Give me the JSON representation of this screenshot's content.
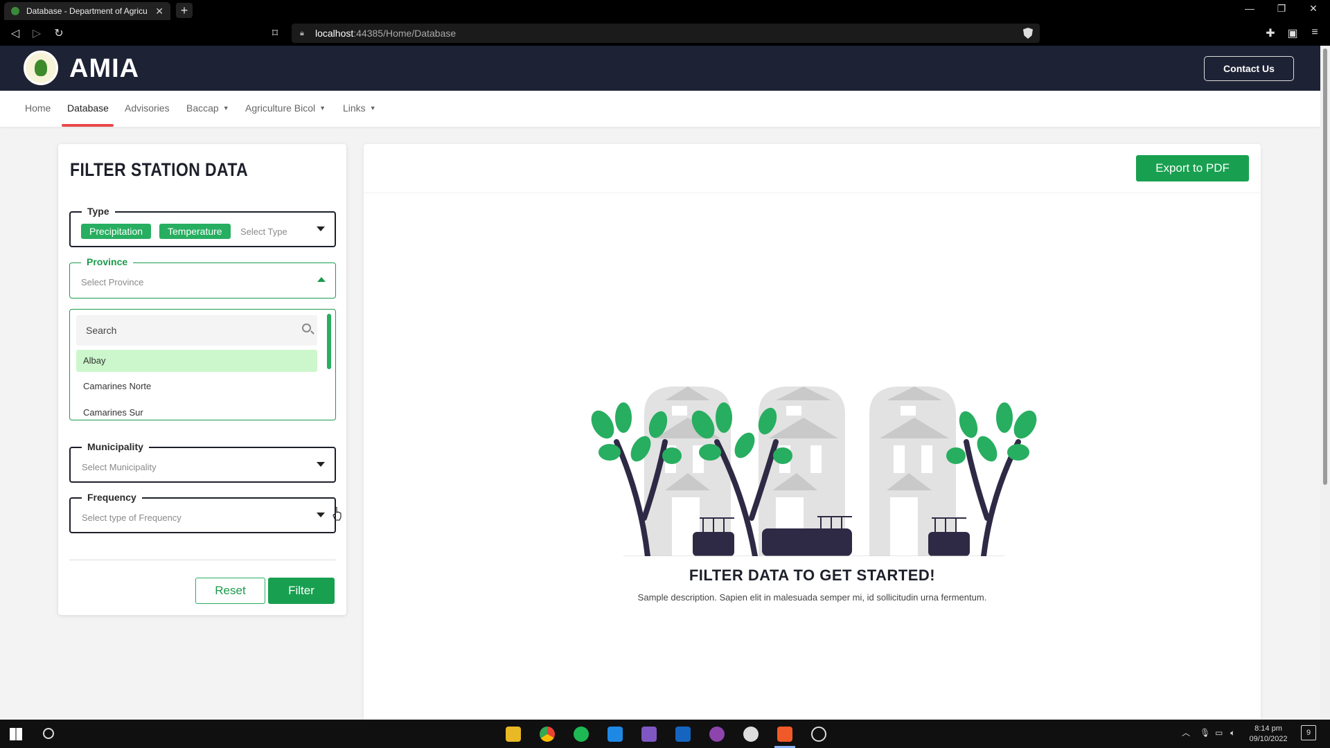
{
  "browser": {
    "tab_title": "Database - Department of Agricu",
    "url_host": "localhost",
    "url_path": ":44385/Home/Database"
  },
  "app": {
    "brand": "AMIA",
    "contact_label": "Contact Us"
  },
  "nav": {
    "items": [
      {
        "label": "Home",
        "active": false,
        "dropdown": false
      },
      {
        "label": "Database",
        "active": true,
        "dropdown": false
      },
      {
        "label": "Advisories",
        "active": false,
        "dropdown": false
      },
      {
        "label": "Baccap",
        "active": false,
        "dropdown": true
      },
      {
        "label": "Agriculture Bicol",
        "active": false,
        "dropdown": true
      },
      {
        "label": "Links",
        "active": false,
        "dropdown": true
      }
    ]
  },
  "filter": {
    "title": "FILTER STATION DATA",
    "type": {
      "legend": "Type",
      "chips": [
        "Precipitation",
        "Temperature"
      ],
      "placeholder": "Select Type"
    },
    "province": {
      "legend": "Province",
      "placeholder": "Select Province",
      "search_placeholder": "Search",
      "options": [
        "Albay",
        "Camarines Norte",
        "Camarines Sur"
      ]
    },
    "municipality": {
      "legend": "Municipality",
      "placeholder": "Select Municipality"
    },
    "frequency": {
      "legend": "Frequency",
      "placeholder": "Select type of Frequency"
    },
    "reset_label": "Reset",
    "filter_label": "Filter"
  },
  "main": {
    "export_label": "Export to PDF",
    "empty_title": "FILTER DATA TO GET STARTED!",
    "empty_desc": "Sample description. Sapien elit in malesuada semper mi, id sollicitudin urna fermentum."
  },
  "taskbar": {
    "time": "8:14 pm",
    "date": "09/10/2022",
    "notifications": "9"
  },
  "colors": {
    "header_bg": "#1e2235",
    "accent_green": "#18a050",
    "active_underline": "#e8484a",
    "highlight_option": "#ccf7cc"
  }
}
